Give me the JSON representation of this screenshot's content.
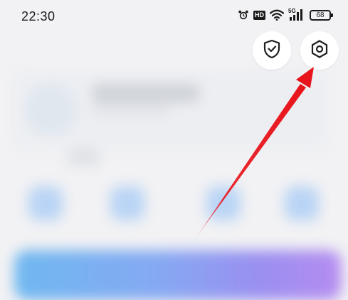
{
  "status_bar": {
    "time": "22:30",
    "alarm_icon": "alarm-clock-icon",
    "hd_label": "HD",
    "wifi_icon": "wifi-icon",
    "network_label": "5G",
    "battery_level": "68"
  },
  "top_actions": {
    "shield_icon": "shield-check-icon",
    "settings_icon": "hexagon-settings-icon"
  },
  "annotation": {
    "arrow_color": "#e8141b"
  },
  "colors": {
    "background": "#f2f2f4",
    "banner_gradient": [
      "#6fb8f0",
      "#86a8f2",
      "#9a8ff0",
      "#b58cf0"
    ]
  }
}
